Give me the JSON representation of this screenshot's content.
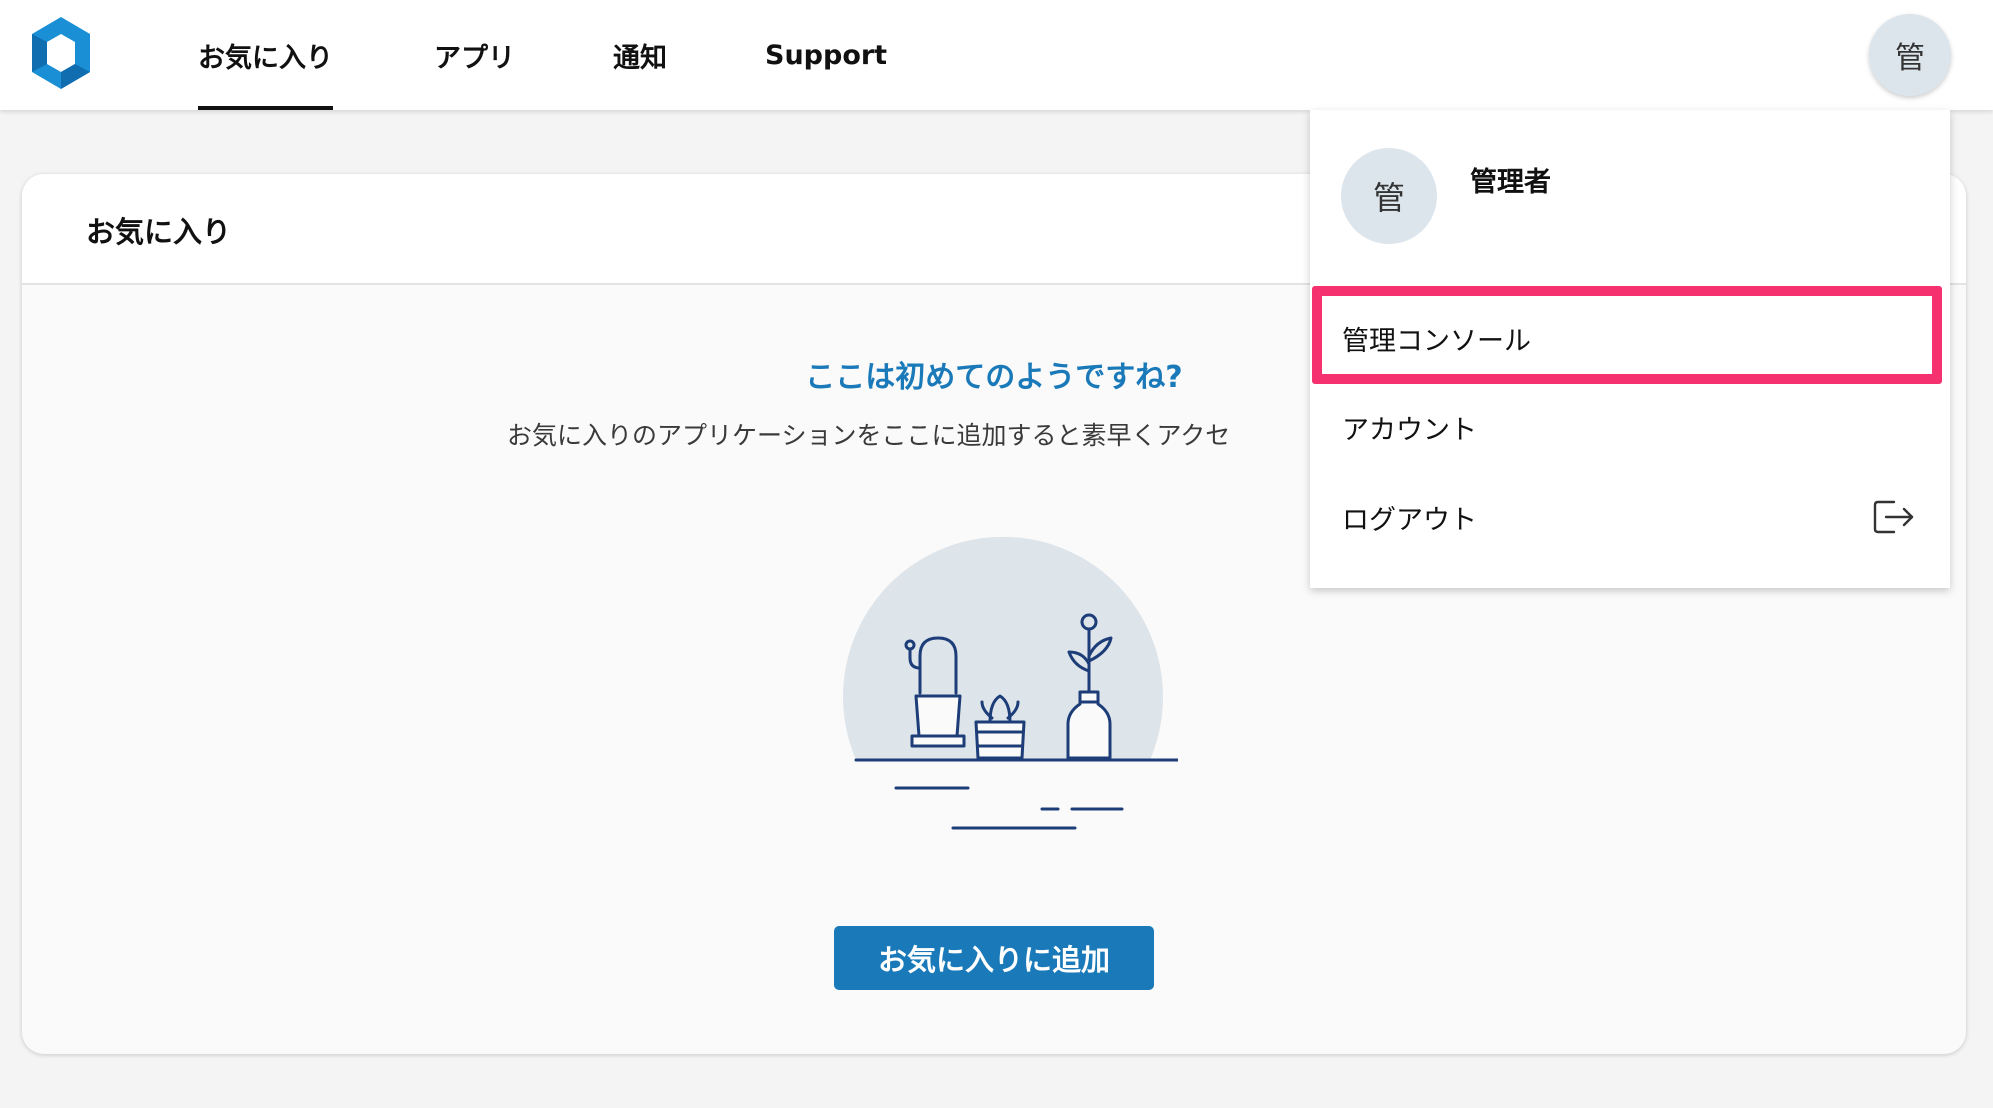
{
  "nav": {
    "tabs": [
      {
        "label": "お気に入り",
        "active": true
      },
      {
        "label": "アプリ"
      },
      {
        "label": "通知"
      },
      {
        "label": "Support"
      }
    ],
    "avatar_initial": "管"
  },
  "card": {
    "title": "お気に入り",
    "empty_title": "ここは初めてのようですね?",
    "empty_description": "お気に入りのアプリケーションをここに追加すると素早くアクセ",
    "add_button": "お気に入りに追加"
  },
  "dropdown": {
    "avatar_initial": "管",
    "user_name": "管理者",
    "items": [
      {
        "label": "管理コンソール",
        "highlighted": true
      },
      {
        "label": "アカウント"
      },
      {
        "label": "ログアウト",
        "icon": "logout-icon"
      }
    ]
  },
  "colors": {
    "accent": "#1a7ab9",
    "highlight": "#f5326f",
    "avatar_bg": "#dde5ec",
    "illustration_bg": "#dde4ea",
    "illustration_line": "#1d3d78"
  }
}
